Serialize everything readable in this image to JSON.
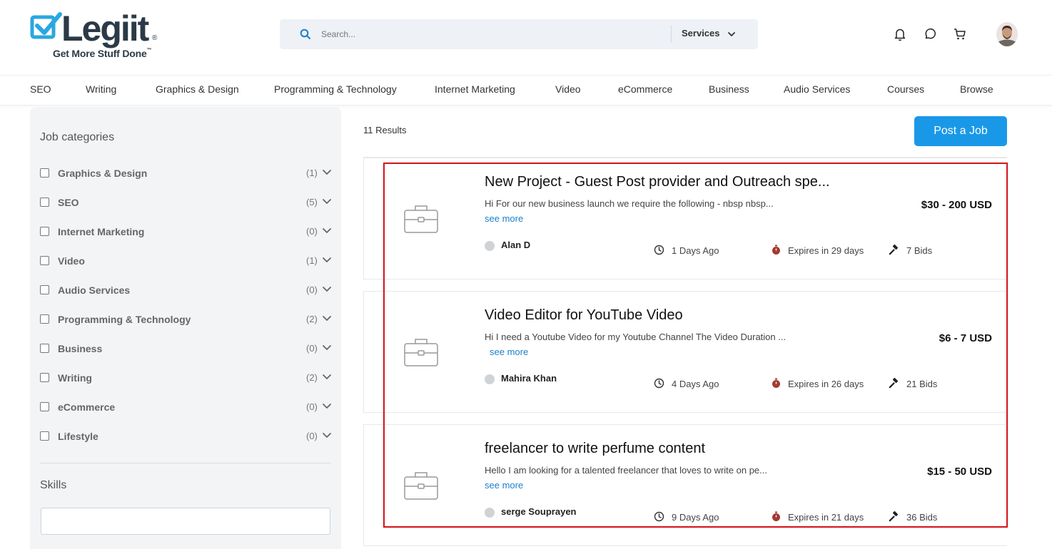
{
  "brand": {
    "name": "Legiit",
    "reg": "®",
    "tagline": "Get More Stuff Done",
    "tm": "™"
  },
  "search": {
    "placeholder": "Search...",
    "category": "Services"
  },
  "nav": {
    "items": [
      "SEO",
      "Writing",
      "Graphics & Design",
      "Programming & Technology",
      "Internet Marketing",
      "Video",
      "eCommerce",
      "Business",
      "Audio Services",
      "Courses",
      "Browse"
    ]
  },
  "sidebar": {
    "categories_title": "Job categories",
    "categories": [
      {
        "label": "Graphics & Design",
        "count": "(1)"
      },
      {
        "label": "SEO",
        "count": "(5)"
      },
      {
        "label": "Internet Marketing",
        "count": "(0)"
      },
      {
        "label": "Video",
        "count": "(1)"
      },
      {
        "label": "Audio Services",
        "count": "(0)"
      },
      {
        "label": "Programming & Technology",
        "count": "(2)"
      },
      {
        "label": "Business",
        "count": "(0)"
      },
      {
        "label": "Writing",
        "count": "(2)"
      },
      {
        "label": "eCommerce",
        "count": "(0)"
      },
      {
        "label": "Lifestyle",
        "count": "(0)"
      }
    ],
    "skills_title": "Skills",
    "skills_value": ""
  },
  "main": {
    "results": "11 Results",
    "post_job": "Post a Job",
    "jobs": [
      {
        "title": "New Project - Guest Post provider and Outreach spe...",
        "desc": "Hi For our new business launch we require the following - nbsp nbsp...",
        "see_more": "see more",
        "price": "$30 - 200 USD",
        "user": "Alan D",
        "posted": "1 Days Ago",
        "expires": "Expires in 29 days",
        "bids": "7 Bids"
      },
      {
        "title": "Video Editor for YouTube Video",
        "desc": "Hi I need a Youtube Video for my Youtube Channel The Video Duration ...",
        "see_more": "see more",
        "price": "$6 - 7 USD",
        "user": "Mahira Khan",
        "posted": "4 Days Ago",
        "expires": "Expires in 26 days",
        "bids": "21 Bids"
      },
      {
        "title": "freelancer to write perfume content",
        "desc": "Hello I am looking for a talented freelancer that loves to write on pe...",
        "see_more": "see more",
        "price": "$15 - 50 USD",
        "user": "serge Souprayen",
        "posted": "9 Days Ago",
        "expires": "Expires in 21 days",
        "bids": "36 Bids"
      }
    ]
  },
  "colors": {
    "accent": "#1a98e8",
    "link": "#1a7fc8",
    "highlight": "#d9161c",
    "expires_icon": "#a33a32"
  },
  "icons": [
    "search-icon",
    "chevron-down-icon",
    "bell-icon",
    "chat-icon",
    "cart-icon",
    "briefcase-icon",
    "user-icon",
    "clock-icon",
    "stopwatch-icon",
    "gavel-icon"
  ]
}
